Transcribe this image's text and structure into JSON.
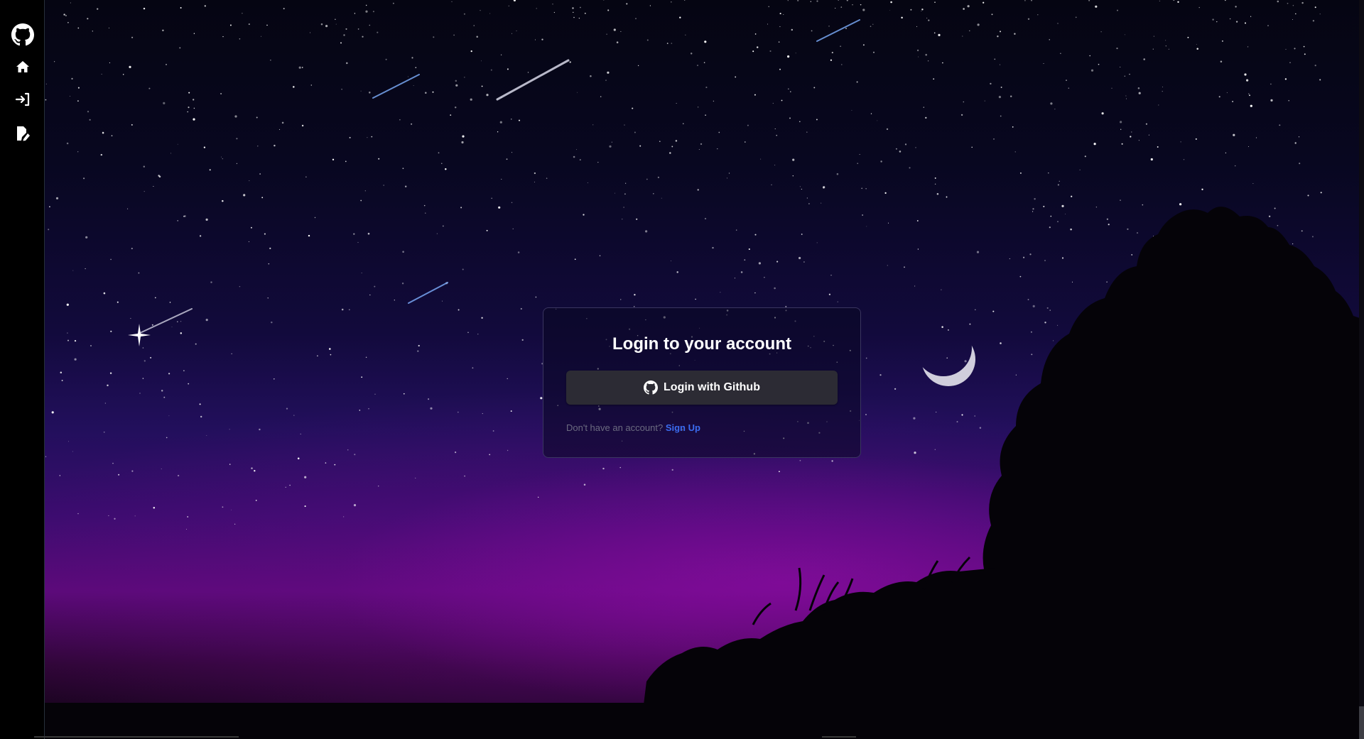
{
  "sidebar": {
    "items": [
      {
        "icon": "github-icon",
        "label": "GitHub"
      },
      {
        "icon": "home-icon",
        "label": "Home"
      },
      {
        "icon": "login-icon",
        "label": "Login"
      },
      {
        "icon": "signup-icon",
        "label": "Sign Up"
      }
    ]
  },
  "login": {
    "title": "Login to your account",
    "github_button_label": "Login with Github",
    "signup_prompt": "Don't have an account?",
    "signup_link": "Sign Up"
  },
  "colors": {
    "accent_link": "#3b6cf0",
    "button_bg": "#2c2b34",
    "sidebar_bg": "#000000"
  }
}
